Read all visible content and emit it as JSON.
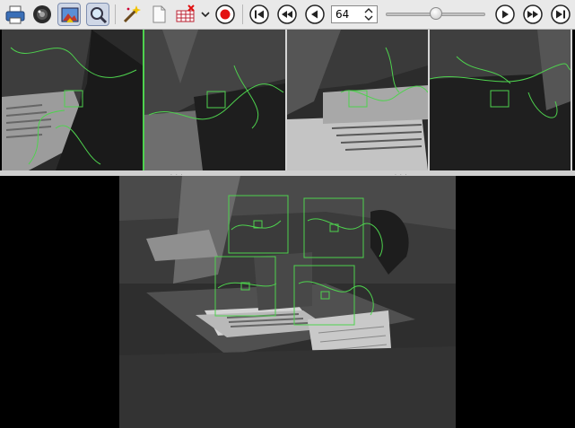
{
  "toolbar": {
    "buttons": [
      {
        "name": "print-button",
        "icon": "printer-icon"
      },
      {
        "name": "camera-button",
        "icon": "camera-lens-icon"
      },
      {
        "name": "image-view-button",
        "icon": "picture-icon",
        "pressed": true
      },
      {
        "name": "zoom-button",
        "icon": "magnifier-icon",
        "pressed": true
      },
      {
        "name": "magic-wand-button",
        "icon": "magic-wand-icon"
      },
      {
        "name": "new-page-button",
        "icon": "blank-page-icon"
      },
      {
        "name": "remove-tracks-button",
        "icon": "grid-x-icon"
      },
      {
        "name": "dropdown-button",
        "icon": "chevron-down-icon"
      },
      {
        "name": "record-button",
        "icon": "record-icon"
      },
      {
        "name": "first-frame-button",
        "icon": "skip-to-start-icon"
      },
      {
        "name": "rewind-button",
        "icon": "rewind-icon"
      },
      {
        "name": "step-back-button",
        "icon": "step-back-icon"
      },
      {
        "name": "play-button",
        "icon": "play-icon"
      },
      {
        "name": "fast-forward-button",
        "icon": "fast-forward-icon"
      },
      {
        "name": "last-frame-button",
        "icon": "skip-to-end-icon"
      }
    ],
    "frame_value": "64",
    "slider_fraction": 0.5
  },
  "colors": {
    "track_green": "#4ed24e",
    "toolbar_bg": "#e9e9e9",
    "record_red": "#e31010"
  }
}
